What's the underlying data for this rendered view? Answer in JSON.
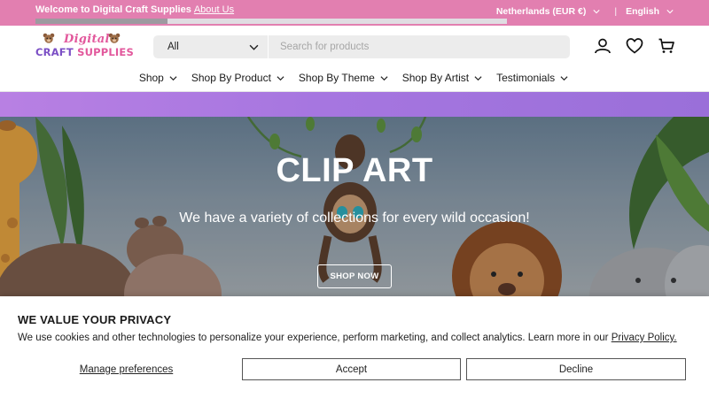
{
  "announcement": {
    "welcome_text": "Welcome to Digital Craft Supplies",
    "about_link": "About Us",
    "progress_fraction": 0.28,
    "country": "Netherlands (EUR €)",
    "separator": "|",
    "language": "English"
  },
  "brand": {
    "line1": "Digital",
    "line2_a": "CRAFT ",
    "line2_b": "SUPPLIES"
  },
  "search": {
    "category": "All",
    "placeholder": "Search for products"
  },
  "header_icons": [
    "account-icon",
    "wishlist-heart-icon",
    "cart-icon"
  ],
  "nav": {
    "items": [
      {
        "label": "Shop"
      },
      {
        "label": "Shop By Product"
      },
      {
        "label": "Shop By Theme"
      },
      {
        "label": "Shop By Artist"
      },
      {
        "label": "Testimonials"
      }
    ]
  },
  "hero": {
    "title": "CLIP ART",
    "subtitle": "We have a variety of collections for every wild occasion!",
    "cta": "SHOP NOW"
  },
  "cookie": {
    "heading": "WE VALUE YOUR PRIVACY",
    "text": "We use cookies and other technologies to personalize your experience, perform marketing, and collect analytics. Learn more in our ",
    "policy_link": "Privacy Policy.",
    "manage": "Manage preferences",
    "accept": "Accept",
    "decline": "Decline"
  },
  "colors": {
    "announcement_bg": "#e27fb0",
    "strip_purple": "#a676e0",
    "brand_pink": "#e2589c",
    "brand_purple": "#7b4fc5"
  }
}
